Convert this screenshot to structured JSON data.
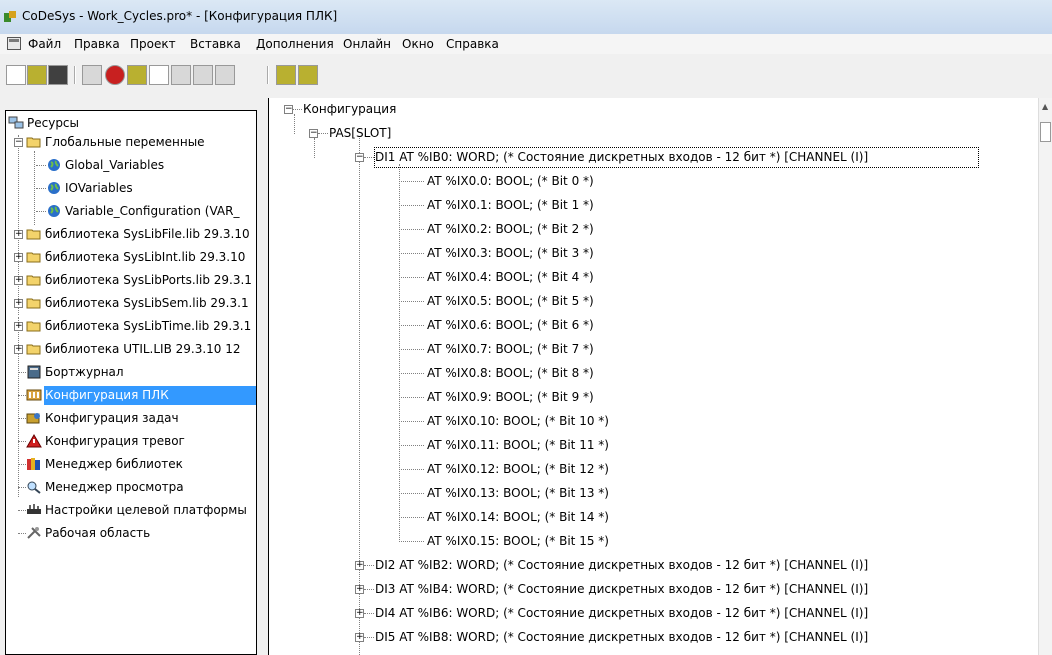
{
  "window": {
    "title": "CoDeSys - Work_Cycles.pro* - [Конфигурация ПЛК]"
  },
  "menu": [
    "Файл",
    "Правка",
    "Проект",
    "Вставка",
    "Дополнения",
    "Онлайн",
    "Окно",
    "Справка"
  ],
  "toolbar": {
    "buttons": [
      "new-icon",
      "open-icon",
      "save-icon",
      "compile-icon",
      "stop-icon",
      "login-icon",
      "logout-icon",
      "run-icon",
      "step-icon",
      "breakpoint-icon",
      "find-icon",
      "replace-icon"
    ]
  },
  "left_tree": {
    "root": "Ресурсы",
    "global_vars": "Глобальные переменные",
    "gv_items": [
      "Global_Variables",
      "IOVariables",
      "Variable_Configuration (VAR_"
    ],
    "libraries": [
      "библиотека SysLibFile.lib 29.3.10",
      "библиотека SysLibInt.lib 29.3.10",
      "библиотека SysLibPorts.lib 29.3.1",
      "библиотека SysLibSem.lib 29.3.1",
      "библиотека SysLibTime.lib 29.3.1",
      "библиотека UTIL.LIB 29.3.10 12"
    ],
    "items": [
      "Бортжурнал",
      "Конфигурация ПЛК",
      "Конфигурация задач",
      "Конфигурация тревог",
      "Менеджер библиотек",
      "Менеджер просмотра",
      "Настройки целевой платформы",
      "Рабочая область"
    ],
    "selected_index": 1
  },
  "right_tree": {
    "root": "Конфигурация",
    "slot": "PAS[SLOT]",
    "di1": "DI1 AT %IB0: WORD; (* Состояние дискретных входов - 12 бит *) [CHANNEL (I)]",
    "bits": [
      "AT %IX0.0: BOOL; (* Bit 0 *)",
      "AT %IX0.1: BOOL; (* Bit 1 *)",
      "AT %IX0.2: BOOL; (* Bit 2 *)",
      "AT %IX0.3: BOOL; (* Bit 3 *)",
      "AT %IX0.4: BOOL; (* Bit 4 *)",
      "AT %IX0.5: BOOL; (* Bit 5 *)",
      "AT %IX0.6: BOOL; (* Bit 6 *)",
      "AT %IX0.7: BOOL; (* Bit 7 *)",
      "AT %IX0.8: BOOL; (* Bit 8 *)",
      "AT %IX0.9: BOOL; (* Bit 9 *)",
      "AT %IX0.10: BOOL; (* Bit 10 *)",
      "AT %IX0.11: BOOL; (* Bit 11 *)",
      "AT %IX0.12: BOOL; (* Bit 12 *)",
      "AT %IX0.13: BOOL; (* Bit 13 *)",
      "AT %IX0.14: BOOL; (* Bit 14 *)",
      "AT %IX0.15: BOOL; (* Bit 15 *)"
    ],
    "di_more": [
      "DI2 AT %IB2: WORD; (* Состояние дискретных входов - 12 бит *) [CHANNEL (I)]",
      "DI3 AT %IB4: WORD; (* Состояние дискретных входов - 12 бит *) [CHANNEL (I)]",
      "DI4 AT %IB6: WORD; (* Состояние дискретных входов - 12 бит *) [CHANNEL (I)]",
      "DI5 AT %IB8: WORD; (* Состояние дискретных входов - 12 бит *) [CHANNEL (I)]"
    ]
  },
  "colors": {
    "selection": "#3399ff",
    "folder": "#f3d36b",
    "globe": "#2a6fc9"
  }
}
